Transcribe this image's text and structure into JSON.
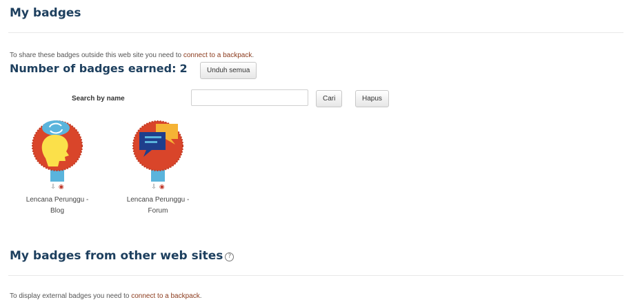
{
  "my_badges": {
    "title": "My badges",
    "share_text": "To share these badges outside this web site you need to ",
    "share_link": "connect to a backpack",
    "share_end": ".",
    "count_label": "Number of badges earned:",
    "count_value": "2",
    "download_all_label": "Unduh semua",
    "search_label": "Search by name",
    "search_value": "",
    "search_button_label": "Cari",
    "clear_button_label": "Hapus",
    "badges": [
      {
        "name_line1": "Lencana Perunggu -",
        "name_line2": "Blog",
        "icon": "head-thinking-icon"
      },
      {
        "name_line1": "Lencana Perunggu -",
        "name_line2": "Forum",
        "icon": "speech-bubbles-icon"
      }
    ]
  },
  "external_badges": {
    "title": "My badges from other web sites",
    "text": "To display external badges you need to ",
    "link": "connect to a backpack",
    "end": "."
  },
  "colors": {
    "heading": "#1d3f5e",
    "badge_circle": "#d9452a",
    "ribbon": "#5ab4dc",
    "link": "#8b3a1c"
  }
}
